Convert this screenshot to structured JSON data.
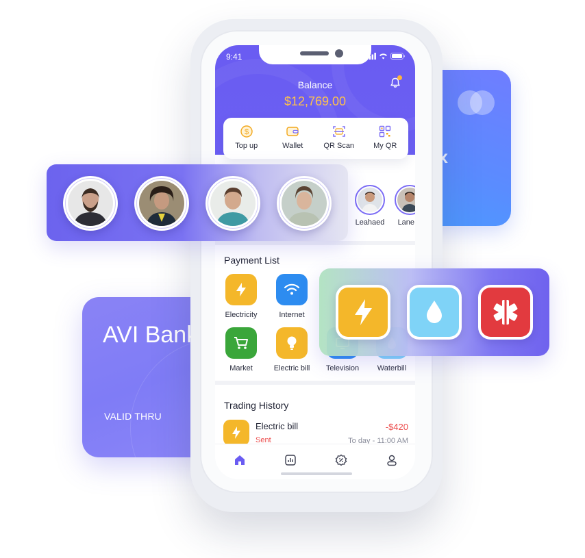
{
  "cards": {
    "left_bank_name": "AVI Bank",
    "left_valid_thru": "VALID THRU",
    "right_masked_text": "xx"
  },
  "status_bar": {
    "time": "9:41"
  },
  "balance": {
    "label": "Balance",
    "value": "$12,769.00"
  },
  "quick_actions": [
    {
      "label": "Top up",
      "icon": "dollar-coin-icon"
    },
    {
      "label": "Wallet",
      "icon": "wallet-icon"
    },
    {
      "label": "QR Scan",
      "icon": "qr-scan-icon"
    },
    {
      "label": "My QR",
      "icon": "qr-code-icon"
    }
  ],
  "contacts": [
    {
      "name": "Leahaed"
    },
    {
      "name": "Lane E"
    }
  ],
  "payment_list": {
    "title": "Payment List",
    "items": [
      {
        "label": "Electricity",
        "icon": "lightning-icon",
        "color": "#f4b72a"
      },
      {
        "label": "Internet",
        "icon": "wifi-icon",
        "color": "#2d8cf0"
      },
      {
        "label": "Market",
        "icon": "cart-icon",
        "color": "#3aa63a"
      },
      {
        "label": "Electric bill",
        "icon": "bulb-icon",
        "color": "#f4b72a"
      },
      {
        "label": "Television",
        "icon": "tv-icon",
        "color": "#2d8cf0"
      },
      {
        "label": "Waterbill",
        "icon": "water-drop-icon",
        "color": "#7fd3f7"
      }
    ]
  },
  "trading_history": {
    "title": "Trading History",
    "items": [
      {
        "title": "Electric bill",
        "amount": "-$420",
        "status": "Sent",
        "date": "To day - 11:00 AM"
      }
    ]
  },
  "tabbar": [
    "home-icon",
    "chart-icon",
    "discount-icon",
    "profile-icon"
  ],
  "overlay_icons": [
    "lightning-icon",
    "water-drop-icon",
    "medical-icon"
  ],
  "colors": {
    "primary": "#6a5cf2",
    "accent_yellow": "#ffc24a",
    "negative": "#ec4a4a"
  }
}
